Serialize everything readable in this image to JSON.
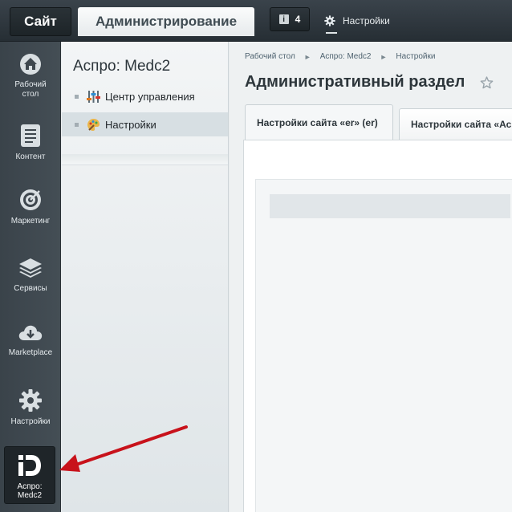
{
  "topbar": {
    "site_label": "Сайт",
    "admin_label": "Администрирование",
    "notifications_count": "4",
    "notifications_icon": "i",
    "settings_label": "Настройки"
  },
  "leftnav": {
    "items": [
      {
        "label_line1": "Рабочий",
        "label_line2": "стол",
        "icon": "home-icon"
      },
      {
        "label_line1": "Контент",
        "label_line2": "",
        "icon": "document-icon"
      },
      {
        "label_line1": "Маркетинг",
        "label_line2": "",
        "icon": "target-icon"
      },
      {
        "label_line1": "Сервисы",
        "label_line2": "",
        "icon": "layers-icon"
      },
      {
        "label_line1": "Marketplace",
        "label_line2": "",
        "icon": "cloud-download-icon"
      },
      {
        "label_line1": "Настройки",
        "label_line2": "",
        "icon": "gear-icon"
      },
      {
        "label_line1": "Аспро:",
        "label_line2": "Medc2",
        "icon": "aspro-logo-icon"
      }
    ]
  },
  "sidebar2": {
    "title": "Аспро: Medc2",
    "items": [
      {
        "label": "Центр управления",
        "icon": "control-center-icon"
      },
      {
        "label": "Настройки",
        "icon": "palette-icon"
      }
    ]
  },
  "main": {
    "breadcrumb": [
      "Рабочий стол",
      "Аспро: Medc2",
      "Настройки"
    ],
    "breadcrumb_separator": "►",
    "page_title": "Административный раздел",
    "tabs": [
      {
        "label": "Настройки сайта «er» (er)"
      },
      {
        "label": "Настройки сайта «Ас"
      }
    ]
  },
  "colors": {
    "topbar_bg": "#2b3339",
    "nav_bg": "#3e474e",
    "accent_arrow": "#c8121b"
  }
}
